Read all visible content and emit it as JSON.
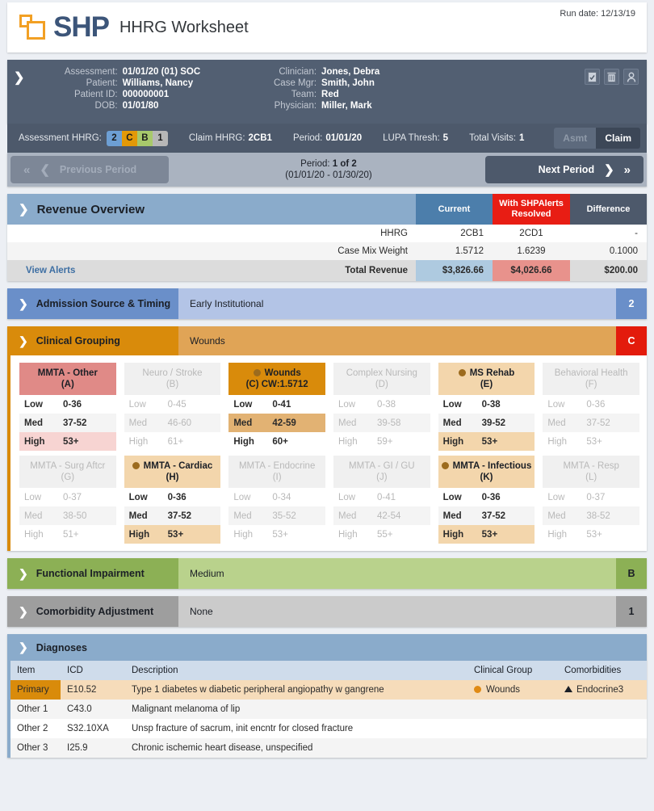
{
  "header": {
    "logo_text": "SHP",
    "app_title": "HHRG Worksheet",
    "run_date_label": "Run date:",
    "run_date_value": "12/13/19"
  },
  "patient": {
    "fields_left": [
      {
        "label": "Assessment:",
        "value": "01/01/20 (01) SOC"
      },
      {
        "label": "Patient:",
        "value": "Williams, Nancy"
      },
      {
        "label": "Patient ID:",
        "value": "000000001"
      },
      {
        "label": "DOB:",
        "value": "01/01/80"
      }
    ],
    "fields_right": [
      {
        "label": "Clinician:",
        "value": "Jones, Debra"
      },
      {
        "label": "Case Mgr:",
        "value": "Smith, John"
      },
      {
        "label": "Team:",
        "value": "Red"
      },
      {
        "label": "Physician:",
        "value": "Miller, Mark"
      }
    ]
  },
  "hhrg": {
    "assessment_label": "Assessment HHRG:",
    "badges": [
      {
        "text": "2",
        "color": "#6d9fd4"
      },
      {
        "text": "C",
        "color": "#e39908"
      },
      {
        "text": "B",
        "color": "#a8c96b"
      },
      {
        "text": "1",
        "color": "#b7b7b7"
      }
    ],
    "claim_label": "Claim HHRG:",
    "claim_value": "2CB1",
    "period_label": "Period:",
    "period_value": "01/01/20",
    "lupa_label": "LUPA Thresh:",
    "lupa_value": "5",
    "visits_label": "Total Visits:",
    "visits_value": "1",
    "toggle_asmt": "Asmt",
    "toggle_claim": "Claim"
  },
  "period_nav": {
    "prev_label": "Previous Period",
    "next_label": "Next Period",
    "center_line1_label": "Period:",
    "center_line1_value": "1 of 2",
    "center_line2": "(01/01/20 - 01/30/20)"
  },
  "revenue": {
    "title": "Revenue Overview",
    "columns": [
      "Current",
      "With SHPAlerts Resolved",
      "Difference"
    ],
    "view_alerts": "View Alerts",
    "rows": [
      {
        "label": "HHRG",
        "current": "2CB1",
        "resolved": "2CD1",
        "difference": "-"
      },
      {
        "label": "Case Mix Weight",
        "current": "1.5712",
        "resolved": "1.6239",
        "difference": "0.1000"
      },
      {
        "label": "Total Revenue",
        "current": "$3,826.66",
        "resolved": "$4,026.66",
        "difference": "$200.00"
      }
    ]
  },
  "admission": {
    "name": "Admission Source & Timing",
    "value": "Early Institutional",
    "score": "2"
  },
  "clinical_grouping": {
    "name": "Clinical Grouping",
    "value": "Wounds",
    "score": "C",
    "groups": [
      {
        "title": "MMTA - Other",
        "code": "(A)",
        "state": "primary",
        "dot": false,
        "levels": [
          {
            "k": "Low",
            "v": "0-36",
            "hl": "none"
          },
          {
            "k": "Med",
            "v": "37-52",
            "hl": "none"
          },
          {
            "k": "High",
            "v": "53+",
            "hl": "pink"
          }
        ]
      },
      {
        "title": "Neuro / Stroke",
        "code": "(B)",
        "state": "inactive",
        "dot": false,
        "levels": [
          {
            "k": "Low",
            "v": "0-45",
            "hl": "none"
          },
          {
            "k": "Med",
            "v": "46-60",
            "hl": "none"
          },
          {
            "k": "High",
            "v": "61+",
            "hl": "none"
          }
        ]
      },
      {
        "title": "Wounds",
        "code": "(C) CW:1.5712",
        "state": "selected",
        "dot": true,
        "levels": [
          {
            "k": "Low",
            "v": "0-41",
            "hl": "none"
          },
          {
            "k": "Med",
            "v": "42-59",
            "hl": "tan"
          },
          {
            "k": "High",
            "v": "60+",
            "hl": "none"
          }
        ]
      },
      {
        "title": "Complex Nursing",
        "code": "(D)",
        "state": "inactive",
        "dot": false,
        "levels": [
          {
            "k": "Low",
            "v": "0-38",
            "hl": "none"
          },
          {
            "k": "Med",
            "v": "39-58",
            "hl": "none"
          },
          {
            "k": "High",
            "v": "59+",
            "hl": "none"
          }
        ]
      },
      {
        "title": "MS Rehab",
        "code": "(E)",
        "state": "soft",
        "dot": true,
        "levels": [
          {
            "k": "Low",
            "v": "0-38",
            "hl": "none"
          },
          {
            "k": "Med",
            "v": "39-52",
            "hl": "none"
          },
          {
            "k": "High",
            "v": "53+",
            "hl": "soft"
          }
        ]
      },
      {
        "title": "Behavioral Health",
        "code": "(F)",
        "state": "inactive",
        "dot": false,
        "levels": [
          {
            "k": "Low",
            "v": "0-36",
            "hl": "none"
          },
          {
            "k": "Med",
            "v": "37-52",
            "hl": "none"
          },
          {
            "k": "High",
            "v": "53+",
            "hl": "none"
          }
        ]
      },
      {
        "title": "MMTA - Surg Aftcr",
        "code": "(G)",
        "state": "inactive",
        "dot": false,
        "levels": [
          {
            "k": "Low",
            "v": "0-37",
            "hl": "none"
          },
          {
            "k": "Med",
            "v": "38-50",
            "hl": "none"
          },
          {
            "k": "High",
            "v": "51+",
            "hl": "none"
          }
        ]
      },
      {
        "title": "MMTA - Cardiac",
        "code": "(H)",
        "state": "soft",
        "dot": true,
        "levels": [
          {
            "k": "Low",
            "v": "0-36",
            "hl": "none"
          },
          {
            "k": "Med",
            "v": "37-52",
            "hl": "none"
          },
          {
            "k": "High",
            "v": "53+",
            "hl": "soft"
          }
        ]
      },
      {
        "title": "MMTA - Endocrine",
        "code": "(I)",
        "state": "inactive",
        "dot": false,
        "levels": [
          {
            "k": "Low",
            "v": "0-34",
            "hl": "none"
          },
          {
            "k": "Med",
            "v": "35-52",
            "hl": "none"
          },
          {
            "k": "High",
            "v": "53+",
            "hl": "none"
          }
        ]
      },
      {
        "title": "MMTA - GI / GU",
        "code": "(J)",
        "state": "inactive",
        "dot": false,
        "levels": [
          {
            "k": "Low",
            "v": "0-41",
            "hl": "none"
          },
          {
            "k": "Med",
            "v": "42-54",
            "hl": "none"
          },
          {
            "k": "High",
            "v": "55+",
            "hl": "none"
          }
        ]
      },
      {
        "title": "MMTA - Infectious",
        "code": "(K)",
        "state": "soft",
        "dot": true,
        "levels": [
          {
            "k": "Low",
            "v": "0-36",
            "hl": "none"
          },
          {
            "k": "Med",
            "v": "37-52",
            "hl": "none"
          },
          {
            "k": "High",
            "v": "53+",
            "hl": "soft"
          }
        ]
      },
      {
        "title": "MMTA - Resp",
        "code": "(L)",
        "state": "inactive",
        "dot": false,
        "levels": [
          {
            "k": "Low",
            "v": "0-37",
            "hl": "none"
          },
          {
            "k": "Med",
            "v": "38-52",
            "hl": "none"
          },
          {
            "k": "High",
            "v": "53+",
            "hl": "none"
          }
        ]
      }
    ]
  },
  "functional": {
    "name": "Functional Impairment",
    "value": "Medium",
    "score": "B"
  },
  "comorbidity": {
    "name": "Comorbidity Adjustment",
    "value": "None",
    "score": "1"
  },
  "diagnoses": {
    "title": "Diagnoses",
    "columns": [
      "Item",
      "ICD",
      "Description",
      "Clinical Group",
      "Comorbidities"
    ],
    "rows": [
      {
        "item": "Primary",
        "icd": "E10.52",
        "description": "Type 1 diabetes w diabetic peripheral angiopathy w gangrene",
        "group": "Wounds",
        "comorbidity": "Endocrine3",
        "primary": true
      },
      {
        "item": "Other 1",
        "icd": "C43.0",
        "description": "Malignant melanoma of lip",
        "group": "",
        "comorbidity": "",
        "primary": false
      },
      {
        "item": "Other 2",
        "icd": "S32.10XA",
        "description": "Unsp fracture of sacrum, init encntr for closed fracture",
        "group": "",
        "comorbidity": "",
        "primary": false
      },
      {
        "item": "Other 3",
        "icd": "I25.9",
        "description": "Chronic ischemic heart disease, unspecified",
        "group": "",
        "comorbidity": "",
        "primary": false
      }
    ]
  }
}
